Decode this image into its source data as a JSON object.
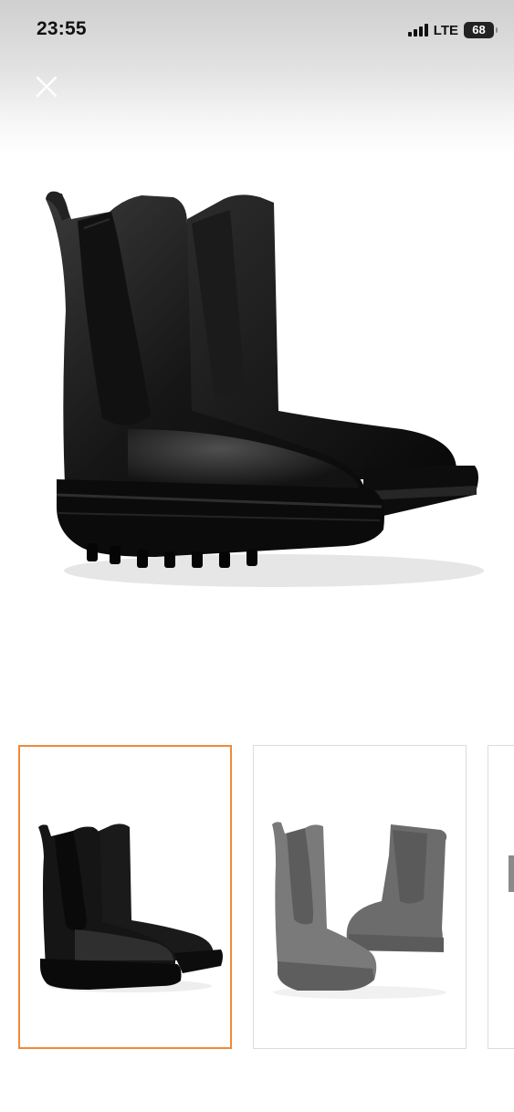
{
  "status_bar": {
    "time": "23:55",
    "network": "LTE",
    "battery": "68"
  },
  "viewer": {
    "close_icon": "close-icon",
    "main_image": {
      "subject": "black-chelsea-boots-pair"
    },
    "thumbnails": [
      {
        "subject": "black-chelsea-boots",
        "selected": true
      },
      {
        "subject": "grey-chelsea-boots",
        "selected": false
      },
      {
        "subject": "partial-thumbnail",
        "selected": false
      }
    ],
    "colors": {
      "selected_border": "#ef8a3a",
      "thumb_border": "#dcdcdc"
    }
  }
}
